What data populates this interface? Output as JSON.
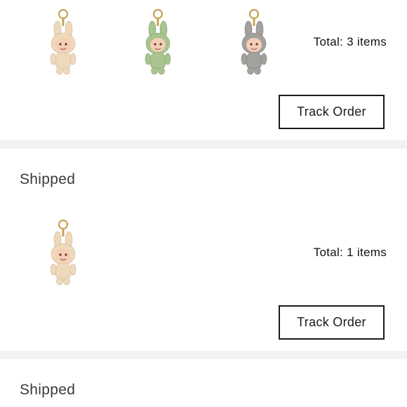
{
  "orders": [
    {
      "items": [
        {
          "icon": "labubu-cream-keychain-icon",
          "color": "#efd9bb"
        },
        {
          "icon": "labubu-green-keychain-icon",
          "color": "#a9c48f"
        },
        {
          "icon": "labubu-grey-keychain-icon",
          "color": "#a3a19e"
        }
      ],
      "total_label": "Total: 3 items",
      "track_label": "Track Order"
    },
    {
      "status": "Shipped",
      "items": [
        {
          "icon": "labubu-cream-keychain-icon",
          "color": "#efd9bb"
        }
      ],
      "total_label": "Total: 1 items",
      "track_label": "Track Order"
    },
    {
      "status": "Shipped"
    }
  ],
  "colors": {
    "divider": "#f2f2f2",
    "button_border": "#1a1a1a",
    "face": "#f6cdb8"
  }
}
